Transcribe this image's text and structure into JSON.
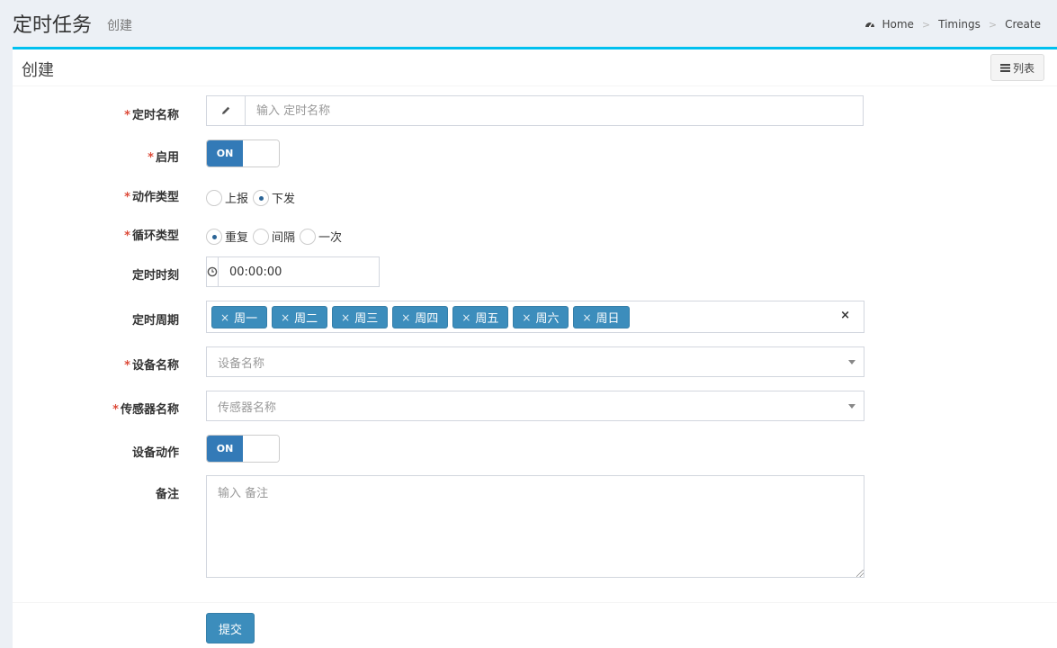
{
  "header": {
    "title": "定时任务",
    "subtitle": "创建",
    "breadcrumb": [
      "Home",
      "Timings",
      "Create"
    ]
  },
  "box": {
    "title": "创建",
    "list_button": "列表"
  },
  "form": {
    "name": {
      "label": "定时名称",
      "placeholder": "输入 定时名称",
      "required": true
    },
    "enabled": {
      "label": "启用",
      "state": "ON",
      "required": true
    },
    "action_type": {
      "label": "动作类型",
      "required": true,
      "options": [
        "上报",
        "下发"
      ],
      "selected": "下发"
    },
    "loop_type": {
      "label": "循环类型",
      "required": true,
      "options": [
        "重复",
        "间隔",
        "一次"
      ],
      "selected": "重复"
    },
    "time": {
      "label": "定时时刻",
      "value": "00:00:00"
    },
    "period": {
      "label": "定时周期",
      "tags": [
        "周一",
        "周二",
        "周三",
        "周四",
        "周五",
        "周六",
        "周日"
      ],
      "tag_remove": "×",
      "clear": "×"
    },
    "device": {
      "label": "设备名称",
      "placeholder": "设备名称",
      "required": true
    },
    "sensor": {
      "label": "传感器名称",
      "placeholder": "传感器名称",
      "required": true
    },
    "device_action": {
      "label": "设备动作",
      "state": "ON"
    },
    "remark": {
      "label": "备注",
      "placeholder": "输入 备注"
    },
    "required_mark": "*",
    "submit": "提交"
  },
  "colors": {
    "primary": "#3c8dbc",
    "accent_top": "#00c0ef",
    "required": "#dd4b39",
    "switch_on": "#337ab7"
  }
}
